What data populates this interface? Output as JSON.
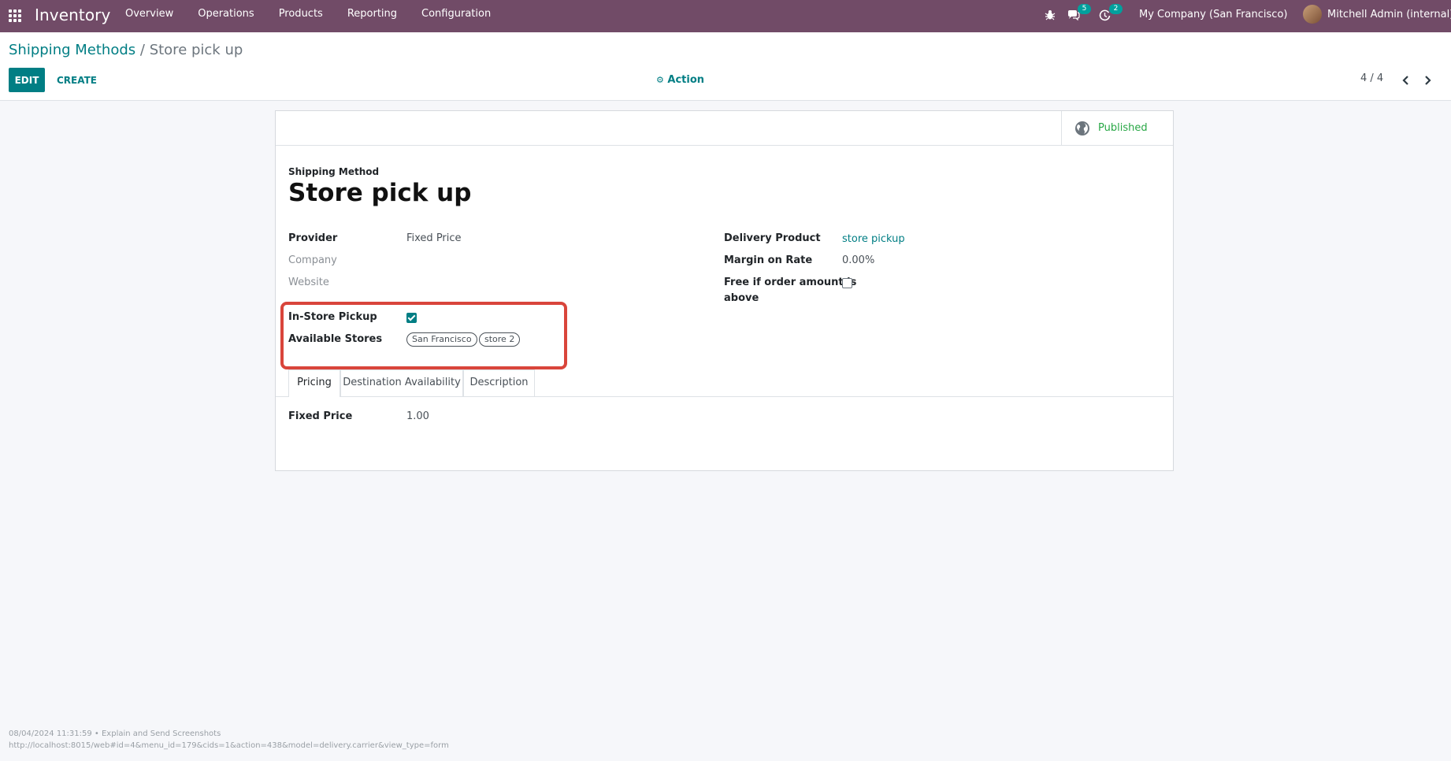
{
  "navbar": {
    "brand": "Inventory",
    "menu": [
      "Overview",
      "Operations",
      "Products",
      "Reporting",
      "Configuration"
    ],
    "messages_count": "5",
    "activities_count": "2",
    "company": "My Company (San Francisco)",
    "user": "Mitchell Admin (internal)",
    "bg_color": "#714b67"
  },
  "control_panel": {
    "breadcrumb_parent": "Shipping Methods",
    "breadcrumb_separator": "/",
    "breadcrumb_current": "Store pick up",
    "edit_label": "EDIT",
    "create_label": "CREATE",
    "action_label": "Action",
    "pager": "4 / 4"
  },
  "form": {
    "published_label": "Published",
    "name_label": "Shipping Method",
    "title": "Store pick up",
    "left": {
      "provider_label": "Provider",
      "provider_value": "Fixed Price",
      "company_label": "Company",
      "website_label": "Website",
      "instore_label": "In-Store Pickup",
      "stores_label": "Available Stores",
      "stores": [
        "San Francisco",
        "store 2"
      ]
    },
    "right": {
      "delivery_product_label": "Delivery Product",
      "delivery_product_value": "store pickup",
      "margin_label": "Margin on Rate",
      "margin_value": "0.00%",
      "free_label_line1": "Free if order amount is",
      "free_label_line2": "above"
    },
    "tabs": [
      "Pricing",
      "Destination Availability",
      "Description"
    ],
    "pricing": {
      "fixed_price_label": "Fixed Price",
      "fixed_price_value": "1.00"
    }
  },
  "footer": {
    "line1": "08/04/2024 11:31:59 • Explain and Send Screenshots",
    "line2": "http://localhost:8015/web#id=4&menu_id=179&cids=1&action=438&model=delivery.carrier&view_type=form"
  },
  "colors": {
    "accent": "#017e84",
    "published": "#28a745",
    "highlight": "#d9453b"
  }
}
